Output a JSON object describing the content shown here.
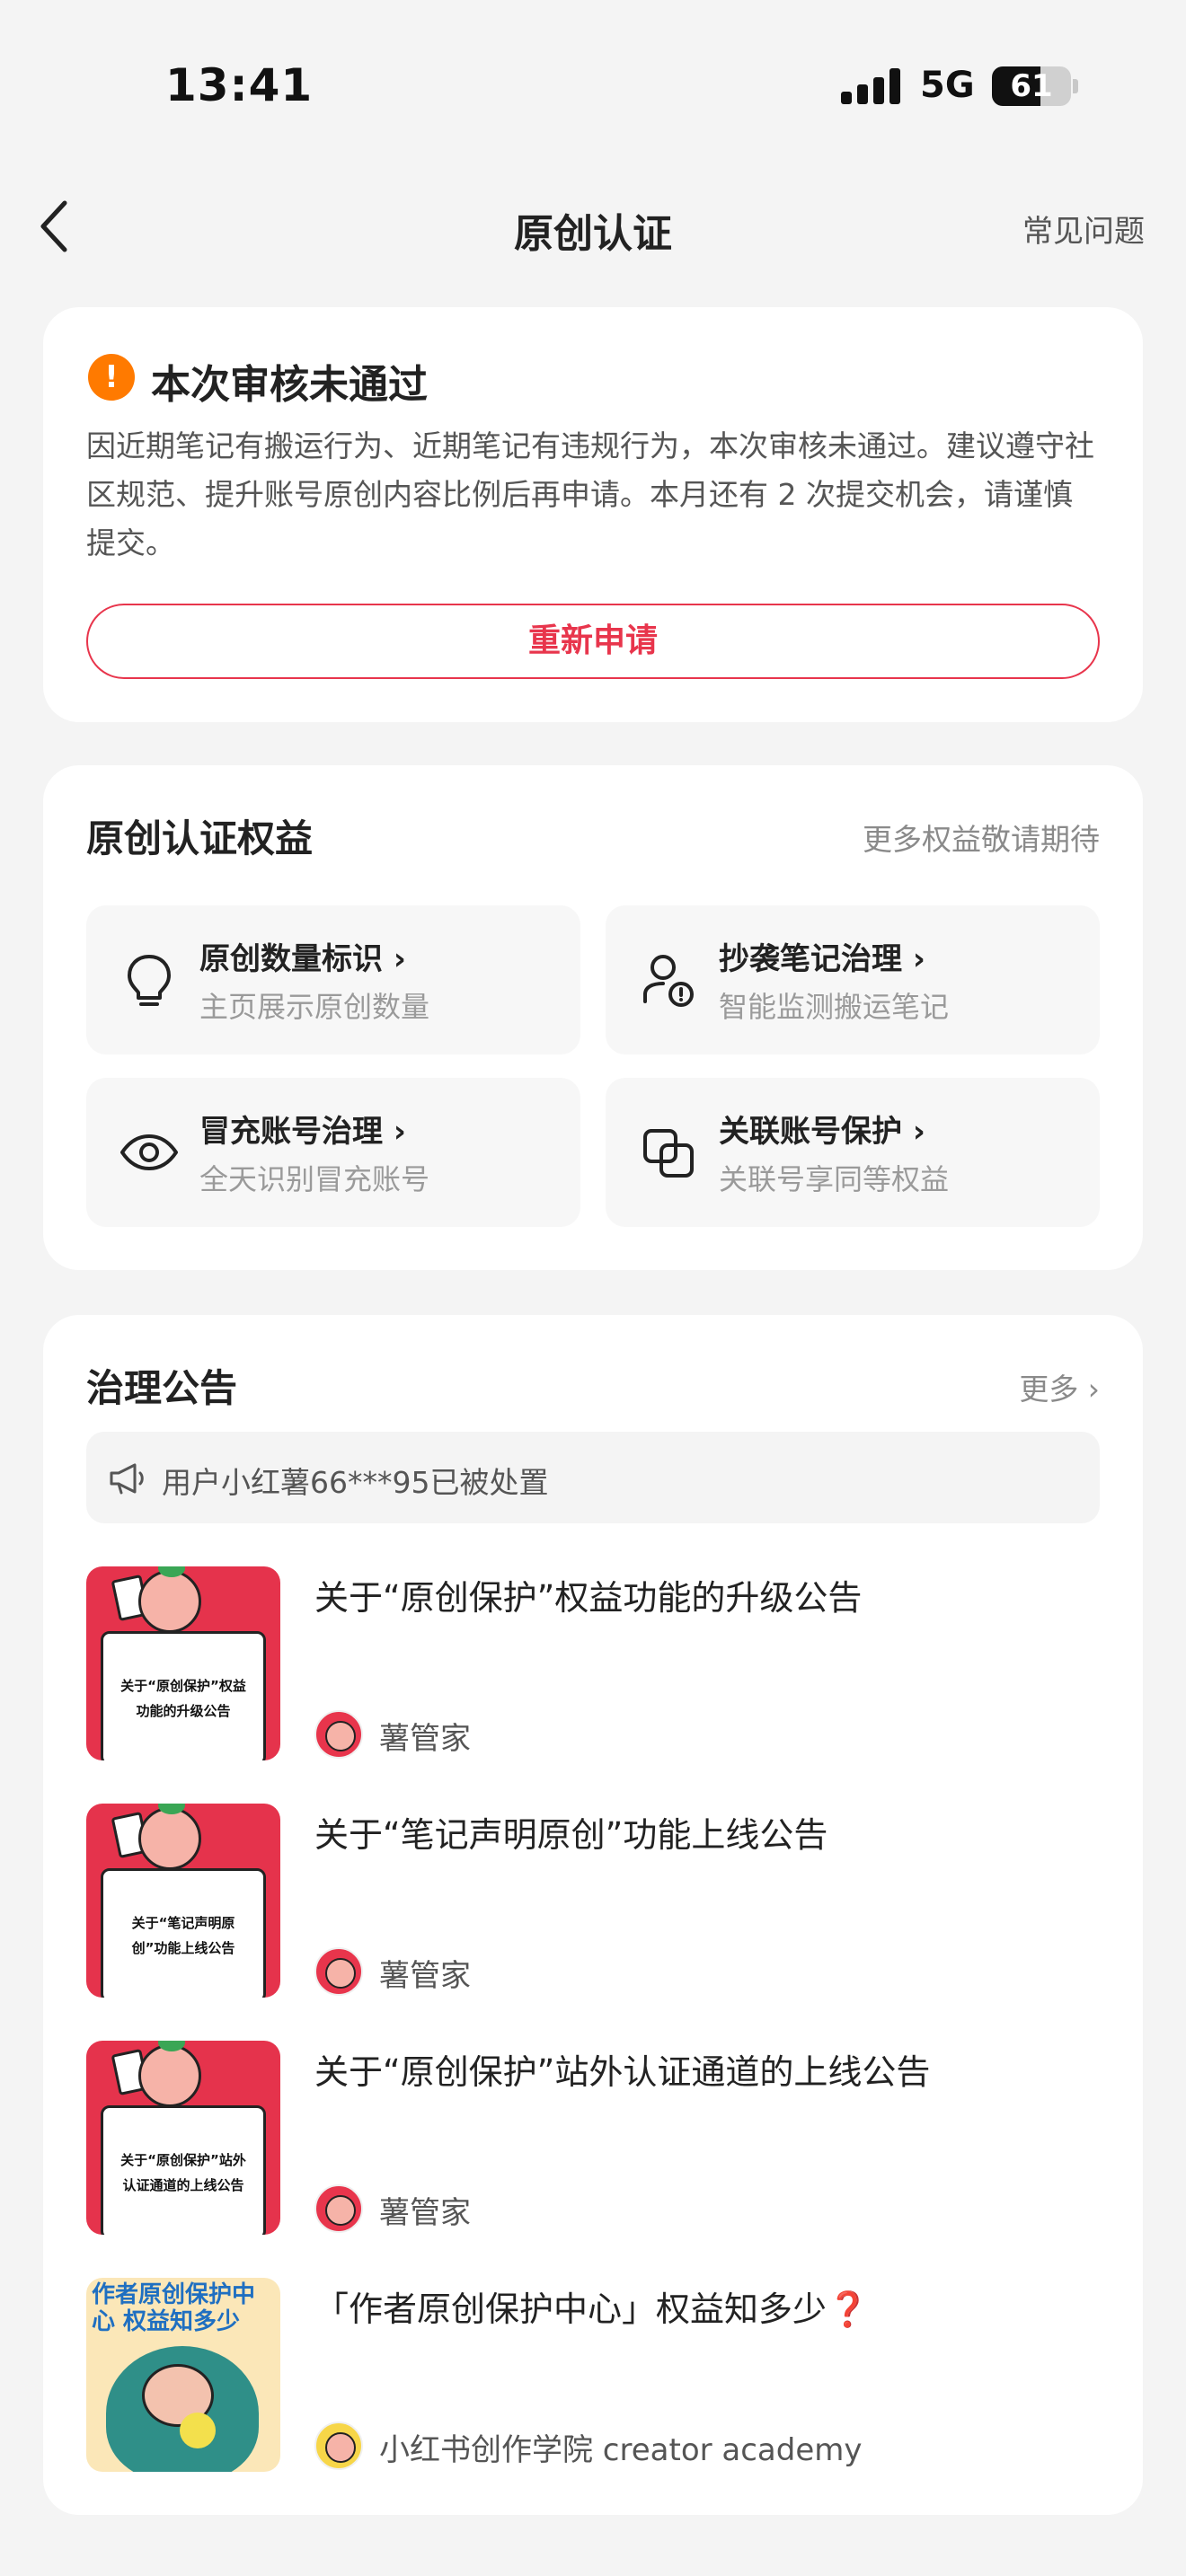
{
  "status_bar": {
    "time": "13:41",
    "network": "5G",
    "battery": "61",
    "battery_level": 0.61
  },
  "nav": {
    "title": "原创认证",
    "faq": "常见问题"
  },
  "review": {
    "title": "本次审核未通过",
    "icon": "warning-icon",
    "body": "因近期笔记有搬运行为、近期笔记有违规行为，本次审核未通过。建议遵守社区规范、提升账号原创内容比例后再申请。本月还有 2 次提交机会，请谨慎提交。",
    "button": "重新申请",
    "accent": "#e8354c"
  },
  "benefits": {
    "title": "原创认证权益",
    "more": "更多权益敬请期待",
    "items": [
      {
        "name": "原创数量标识",
        "desc": "主页展示原创数量",
        "icon": "lightbulb-icon"
      },
      {
        "name": "抄袭笔记治理",
        "desc": "智能监测搬运笔记",
        "icon": "user-warning-icon"
      },
      {
        "name": "冒充账号治理",
        "desc": "全天识别冒充账号",
        "icon": "eye-icon"
      },
      {
        "name": "关联账号保护",
        "desc": "关联号享同等权益",
        "icon": "linked-accounts-icon"
      }
    ]
  },
  "notices": {
    "title": "治理公告",
    "more": "更多",
    "ticker": "用户小红薯66***95已被处置",
    "articles": [
      {
        "title": "关于“原创保护”权益功能的升级公告",
        "thumb_text": "关于“原创保护”权益功能的升级公告",
        "author": "薯管家"
      },
      {
        "title": "关于“笔记声明原创”功能上线公告",
        "thumb_text": "关于“笔记声明原创”功能上线公告",
        "author": "薯管家"
      },
      {
        "title": "关于“原创保护”站外认证通道的上线公告",
        "thumb_text": "关于“原创保护”站外认证通道的上线公告",
        "author": "薯管家"
      },
      {
        "title": "「作者原创保护中心」权益知多少❓",
        "thumb_text": "作者原创保护中心 权益知多少",
        "author": "小红书创作学院 creator academy"
      }
    ]
  }
}
